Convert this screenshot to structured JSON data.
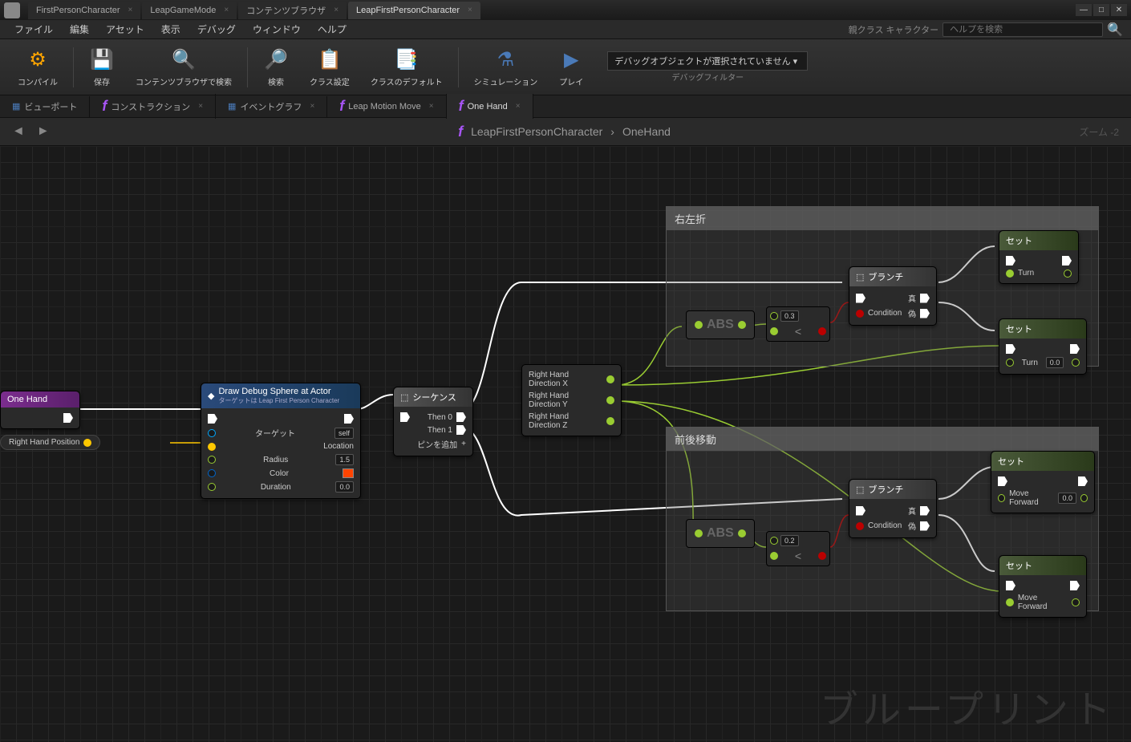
{
  "titlebar": {
    "tabs": [
      {
        "label": "FirstPersonCharacter"
      },
      {
        "label": "LeapGameMode"
      },
      {
        "label": "コンテンツブラウザ"
      },
      {
        "label": "LeapFirstPersonCharacter",
        "active": true
      }
    ]
  },
  "menubar": {
    "items": [
      "ファイル",
      "編集",
      "アセット",
      "表示",
      "デバッグ",
      "ウィンドウ",
      "ヘルプ"
    ],
    "parent_class_label": "親クラス",
    "parent_class": "キャラクター",
    "search_placeholder": "ヘルプを検索"
  },
  "toolbar": {
    "compile": "コンパイル",
    "save": "保存",
    "browse": "コンテンツブラウザで検索",
    "search": "検索",
    "class_settings": "クラス設定",
    "class_defaults": "クラスのデフォルト",
    "simulation": "シミュレーション",
    "play": "プレイ",
    "debug_none": "デバッグオブジェクトが選択されていません",
    "debug_filter": "デバッグフィルター"
  },
  "secondary_tabs": [
    {
      "label": "ビューポート",
      "icon": "▦"
    },
    {
      "label": "コンストラクション",
      "icon": "f"
    },
    {
      "label": "イベントグラフ",
      "icon": "▦"
    },
    {
      "label": "Leap Motion Move",
      "icon": "f"
    },
    {
      "label": "One Hand",
      "icon": "f",
      "active": true
    }
  ],
  "graph_header": {
    "breadcrumb_parent": "LeapFirstPersonCharacter",
    "breadcrumb_child": "OneHand",
    "zoom": "ズーム -2"
  },
  "nodes": {
    "entry": {
      "title": "One Hand"
    },
    "debug_sphere": {
      "title": "Draw Debug Sphere at Actor",
      "subtitle": "ターゲットは Leap First Person Character",
      "target": "ターゲット",
      "target_val": "self",
      "location": "Location",
      "radius": "Radius",
      "radius_val": "1.5",
      "color": "Color",
      "duration": "Duration",
      "duration_val": "0.0"
    },
    "rhp": {
      "label": "Right Hand Position"
    },
    "sequence": {
      "title": "シーケンス",
      "then0": "Then 0",
      "then1": "Then 1",
      "add_pin": "ピンを追加"
    },
    "rhd": {
      "x": "Right Hand Direction X",
      "y": "Right Hand Direction Y",
      "z": "Right Hand Direction Z"
    },
    "comment1": "右左折",
    "comment2": "前後移動",
    "branch": {
      "title": "ブランチ",
      "condition": "Condition",
      "true": "真",
      "false": "偽"
    },
    "set": {
      "title": "セット"
    },
    "turn": "Turn",
    "turn_val": "0.0",
    "move_forward": "Move Forward",
    "move_forward_val": "0.0",
    "compare_val1": "0.3",
    "compare_val2": "0.2",
    "abs": "ABS"
  },
  "watermark": "ブループリント"
}
